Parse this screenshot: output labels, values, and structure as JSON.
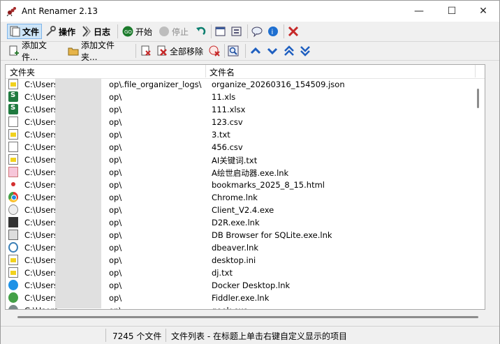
{
  "window": {
    "title": "Ant Renamer 2.13",
    "minimize": "—",
    "maximize": "☐",
    "close": "✕"
  },
  "toolbar1": {
    "file_tab": "文件",
    "action_tab": "操作",
    "log_tab": "日志",
    "start": "开始",
    "stop": "停止"
  },
  "toolbar2": {
    "add_files": "添加文件...",
    "add_folders": "添加文件夹...",
    "remove_all": "全部移除"
  },
  "list": {
    "col_folder": "文件夹",
    "col_name": "文件名",
    "rows": [
      {
        "folder": "C:\\Users",
        "folder_tail": "op\\.file_organizer_logs\\",
        "name": "organize_20260316_154509.json",
        "icon": "doc-y"
      },
      {
        "folder": "C:\\Users",
        "folder_tail": "op\\",
        "name": "11.xls",
        "icon": "xls"
      },
      {
        "folder": "C:\\Users",
        "folder_tail": "op\\",
        "name": "111.xlsx",
        "icon": "xls"
      },
      {
        "folder": "C:\\Users",
        "folder_tail": "op\\",
        "name": "123.csv",
        "icon": "doc"
      },
      {
        "folder": "C:\\Users",
        "folder_tail": "op\\",
        "name": "3.txt",
        "icon": "doc-y"
      },
      {
        "folder": "C:\\Users",
        "folder_tail": "op\\",
        "name": "456.csv",
        "icon": "doc"
      },
      {
        "folder": "C:\\Users",
        "folder_tail": "op\\",
        "name": "AI关键词.txt",
        "icon": "doc-y"
      },
      {
        "folder": "C:\\Users",
        "folder_tail": "op\\",
        "name": "A绘世启动器.exe.lnk",
        "icon": "pink"
      },
      {
        "folder": "C:\\Users",
        "folder_tail": "op\\",
        "name": "bookmarks_2025_8_15.html",
        "icon": "ant"
      },
      {
        "folder": "C:\\Users",
        "folder_tail": "op\\",
        "name": "Chrome.lnk",
        "icon": "round-chrome"
      },
      {
        "folder": "C:\\Users",
        "folder_tail": "op\\",
        "name": "Client_V2.4.exe",
        "icon": "face"
      },
      {
        "folder": "C:\\Users",
        "folder_tail": "op\\",
        "name": "D2R.exe.lnk",
        "icon": "dark"
      },
      {
        "folder": "C:\\Users",
        "folder_tail": "op\\",
        "name": "DB Browser for SQLite.exe.lnk",
        "icon": "sqlite"
      },
      {
        "folder": "C:\\Users",
        "folder_tail": "op\\",
        "name": "dbeaver.lnk",
        "icon": "beaver"
      },
      {
        "folder": "C:\\Users",
        "folder_tail": "op\\",
        "name": "desktop.ini",
        "icon": "doc-y"
      },
      {
        "folder": "C:\\Users",
        "folder_tail": "op\\",
        "name": "dj.txt",
        "icon": "doc-y"
      },
      {
        "folder": "C:\\Users",
        "folder_tail": "op\\",
        "name": "Docker Desktop.lnk",
        "icon": "docker"
      },
      {
        "folder": "C:\\Users",
        "folder_tail": "op\\",
        "name": "Fiddler.exe.lnk",
        "icon": "fiddler"
      },
      {
        "folder": "C:\\Users",
        "folder_tail": "op\\",
        "name": "geek.exe",
        "icon": "gray"
      }
    ]
  },
  "status": {
    "count": "7245 个文件",
    "hint": "文件列表 - 在标题上单击右键自定义显示的项目"
  }
}
